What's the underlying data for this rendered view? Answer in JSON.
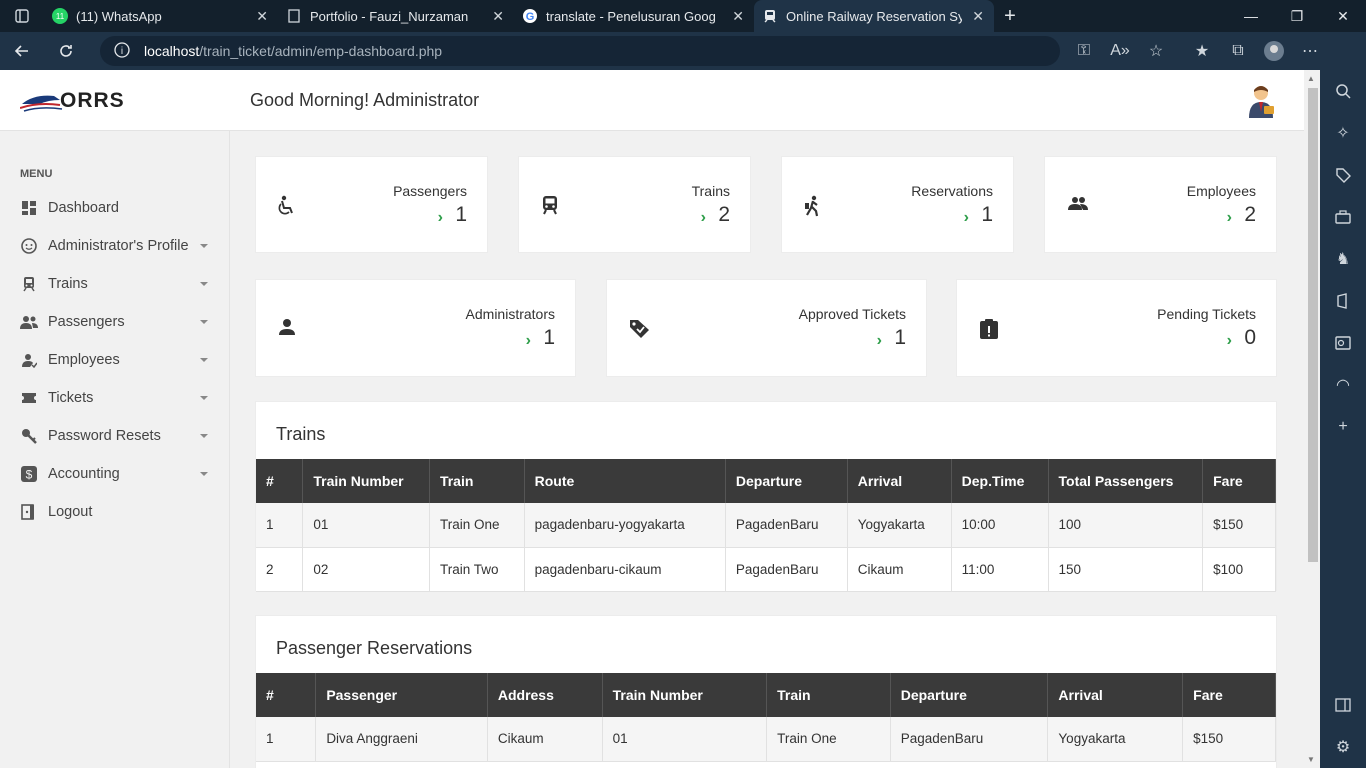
{
  "browser": {
    "tabs": [
      {
        "title": "(11) WhatsApp",
        "icon": "whatsapp-icon",
        "badge": "11"
      },
      {
        "title": "Portfolio - Fauzi_Nurzaman",
        "icon": "page-icon"
      },
      {
        "title": "translate - Penelusuran Google",
        "icon": "google-icon"
      },
      {
        "title": "Online Railway Reservation Syste",
        "icon": "train-icon",
        "active": true
      }
    ],
    "url_host": "localhost",
    "url_path": "/train_ticket/admin/emp-dashboard.php"
  },
  "header": {
    "logo_text": "ORRS",
    "greeting": "Good Morning! Administrator"
  },
  "sidebar": {
    "menu_label": "MENU",
    "items": [
      {
        "label": "Dashboard",
        "icon": "dashboard-icon",
        "caret": false
      },
      {
        "label": "Administrator's Profile",
        "icon": "face-icon",
        "caret": true
      },
      {
        "label": "Trains",
        "icon": "train-icon",
        "caret": true
      },
      {
        "label": "Passengers",
        "icon": "people-icon",
        "caret": true
      },
      {
        "label": "Employees",
        "icon": "employee-icon",
        "caret": true
      },
      {
        "label": "Tickets",
        "icon": "ticket-icon",
        "caret": true
      },
      {
        "label": "Password Resets",
        "icon": "key-icon",
        "caret": true
      },
      {
        "label": "Accounting",
        "icon": "dollar-icon",
        "caret": true
      },
      {
        "label": "Logout",
        "icon": "logout-icon",
        "caret": false
      }
    ]
  },
  "stats": {
    "passengers": {
      "label": "Passengers",
      "value": "1"
    },
    "trains": {
      "label": "Trains",
      "value": "2"
    },
    "reservations": {
      "label": "Reservations",
      "value": "1"
    },
    "employees": {
      "label": "Employees",
      "value": "2"
    },
    "administrators": {
      "label": "Administrators",
      "value": "1"
    },
    "approved": {
      "label": "Approved Tickets",
      "value": "1"
    },
    "pending": {
      "label": "Pending Tickets",
      "value": "0"
    }
  },
  "trains_table": {
    "title": "Trains",
    "headers": [
      "#",
      "Train Number",
      "Train",
      "Route",
      "Departure",
      "Arrival",
      "Dep.Time",
      "Total Passengers",
      "Fare"
    ],
    "rows": [
      [
        "1",
        "01",
        "Train One",
        "pagadenbaru-yogyakarta",
        "PagadenBaru",
        "Yogyakarta",
        "10:00",
        "100",
        "$150"
      ],
      [
        "2",
        "02",
        "Train Two",
        "pagadenbaru-cikaum",
        "PagadenBaru",
        "Cikaum",
        "11:00",
        "150",
        "$100"
      ]
    ]
  },
  "reservations_table": {
    "title": "Passenger Reservations",
    "headers": [
      "#",
      "Passenger",
      "Address",
      "Train Number",
      "Train",
      "Departure",
      "Arrival",
      "Fare"
    ],
    "rows": [
      [
        "1",
        "Diva Anggraeni",
        "Cikaum",
        "01",
        "Train One",
        "PagadenBaru",
        "Yogyakarta",
        "$150"
      ]
    ]
  },
  "colors": {
    "accent_green": "#2e9e4a",
    "table_header": "#3a3a3a"
  }
}
